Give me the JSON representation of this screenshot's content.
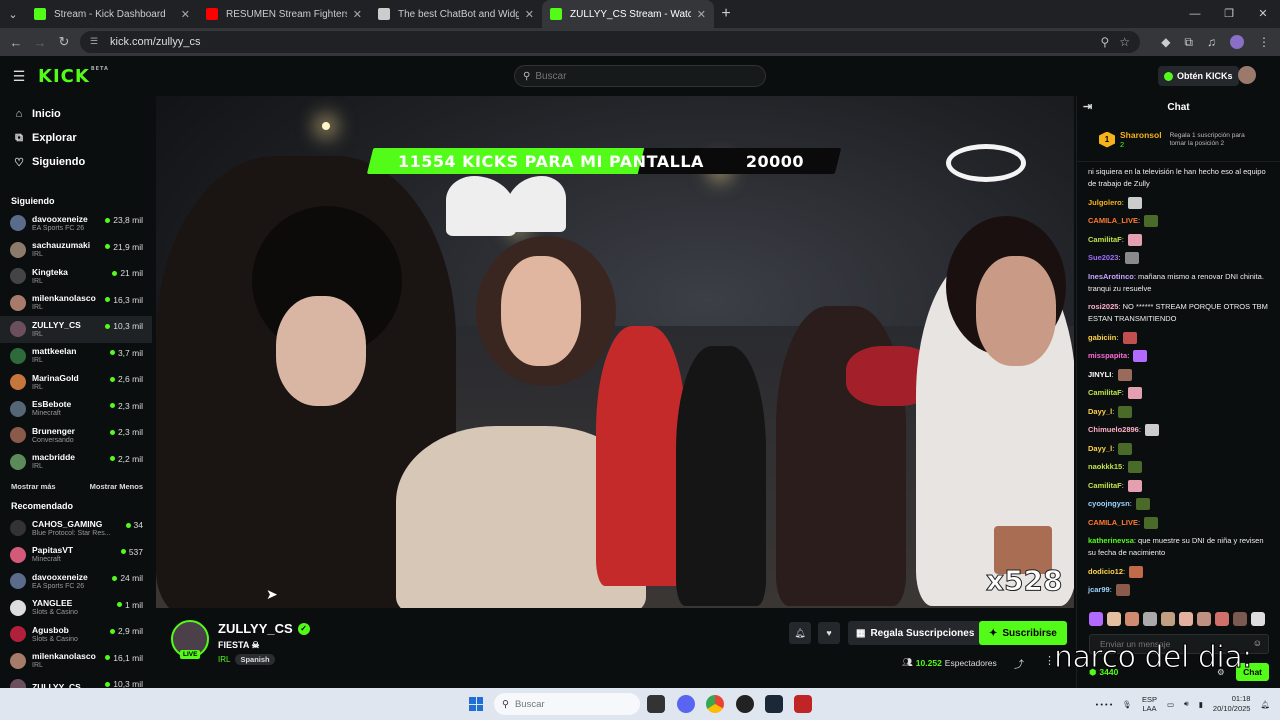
{
  "browser": {
    "tabs": [
      {
        "title": "Stream - Kick Dashboard",
        "color": "#53fc18",
        "active": false
      },
      {
        "title": "RESUMEN Stream Fighters",
        "color": "#ff0000",
        "active": false
      },
      {
        "title": "The best ChatBot and Widgets",
        "color": "#cccccc",
        "active": false
      },
      {
        "title": "ZULLYY_CS Stream - Watch",
        "color": "#53fc18",
        "active": true
      }
    ],
    "url": "kick.com/zullyy_cs"
  },
  "header": {
    "logo": "KICK",
    "logo_badge": "BETA",
    "search_placeholder": "Buscar",
    "kicks_button": "Obtén KICKs"
  },
  "sidebar": {
    "nav": [
      {
        "label": "Inicio",
        "icon": "home-icon"
      },
      {
        "label": "Explorar",
        "icon": "explore-icon"
      },
      {
        "label": "Siguiendo",
        "icon": "heart-icon"
      }
    ],
    "following_title": "Siguiendo",
    "following": [
      {
        "name": "davooxeneize",
        "category": "EA Sports FC 26",
        "viewers": "23,8 mil",
        "color": "#5a6b8c"
      },
      {
        "name": "sachauzumaki",
        "category": "IRL",
        "viewers": "21,9 mil",
        "color": "#8c7a6b"
      },
      {
        "name": "Kingteka",
        "category": "IRL",
        "viewers": "21 mil",
        "color": "#444444"
      },
      {
        "name": "milenkanolasco",
        "category": "IRL",
        "viewers": "16,3 mil",
        "color": "#a77b6a"
      },
      {
        "name": "ZULLYY_CS",
        "category": "IRL",
        "viewers": "10,3 mil",
        "color": "#6b4f5c",
        "selected": true
      },
      {
        "name": "mattkeelan",
        "category": "IRL",
        "viewers": "3,7 mil",
        "color": "#2f6b3a"
      },
      {
        "name": "MarinaGold",
        "category": "IRL",
        "viewers": "2,6 mil",
        "color": "#c6763a"
      },
      {
        "name": "EsBebote",
        "category": "Minecraft",
        "viewers": "2,3 mil",
        "color": "#556677"
      },
      {
        "name": "Brunenger",
        "category": "Conversando",
        "viewers": "2,3 mil",
        "color": "#8a5a4a"
      },
      {
        "name": "macbridde",
        "category": "IRL",
        "viewers": "2,2 mil",
        "color": "#5c8a5a"
      }
    ],
    "show_more": "Mostrar más",
    "show_less": "Mostrar Menos",
    "recommended_title": "Recomendado",
    "recommended": [
      {
        "name": "CAHOS_GAMING",
        "category": "Blue Protocol: Star Res...",
        "viewers": "34",
        "color": "#333333"
      },
      {
        "name": "PapitasVT",
        "category": "Minecraft",
        "viewers": "537",
        "color": "#d45a7a"
      },
      {
        "name": "davooxeneize",
        "category": "EA Sports FC 26",
        "viewers": "24 mil",
        "color": "#5a6b8c"
      },
      {
        "name": "YANGLEE",
        "category": "Slots & Casino",
        "viewers": "1 mil",
        "color": "#dddddd"
      },
      {
        "name": "Agusbob",
        "category": "Slots & Casino",
        "viewers": "2,9 mil",
        "color": "#b0203a"
      },
      {
        "name": "milenkanolasco",
        "category": "IRL",
        "viewers": "16,1 mil",
        "color": "#a77b6a"
      },
      {
        "name": "ZULLYY_CS",
        "category": "",
        "viewers": "10,3 mil",
        "color": "#6b4f5c"
      }
    ]
  },
  "video": {
    "goal_current": "11554",
    "goal_title": "KICKS PARA MI PANTALLA",
    "goal_target": "20000",
    "goal_progress": 0.578,
    "combo": "x528"
  },
  "stream": {
    "name": "ZULLYY_CS",
    "title": "FIESTA ☠",
    "category": "IRL",
    "language": "Spanish",
    "live_badge": "LIVE",
    "gift_button": "Regala Suscripciones",
    "subscribe_button": "Suscribirse",
    "viewers": "10.252",
    "viewers_label": "Espectadores"
  },
  "chat": {
    "title": "Chat",
    "pinned": {
      "rank": "1",
      "user": "Sharonsol",
      "count": "2",
      "note": "Regala 1 suscripción para tomar la posición 2"
    },
    "messages": [
      {
        "user": "",
        "color": "#ffffff",
        "text": "ni siquiera en la televisión le han hecho eso al equipo de trabajo de Zully"
      },
      {
        "user": "Julgolero",
        "color": "#f6b21b",
        "text": "",
        "emote": "#cccccc"
      },
      {
        "user": "CAMILA_LIVE",
        "color": "#ff7a2f",
        "text": "",
        "emote": "#4a6a2a"
      },
      {
        "user": "CamilitaF",
        "color": "#bfe34a",
        "text": "",
        "emote": "#e4a0b0"
      },
      {
        "user": "Sue2023",
        "color": "#a06bff",
        "text": "",
        "emote": "#8a8a8a"
      },
      {
        "user": "InesArotinco",
        "color": "#c7a6ff",
        "text": "mañana mismo a renovar DNI chinita. tranqui zu resuelve"
      },
      {
        "user": "rosi2025",
        "color": "#ffb0c8",
        "text": "NO ****** STREAM PORQUE OTROS TBM ESTAN TRANSMITIENDO"
      },
      {
        "user": "gabiciin",
        "color": "#ffd24a",
        "text": "",
        "emote": "#c05050"
      },
      {
        "user": "misspapita",
        "color": "#ff6ad5",
        "text": "",
        "emote": "#b36bff"
      },
      {
        "user": "JINYLI",
        "color": "#ffffff",
        "text": "",
        "emote": "#9a6a5a"
      },
      {
        "user": "CamilitaF",
        "color": "#bfe34a",
        "text": "",
        "emote": "#e4a0b0"
      },
      {
        "user": "Dayy_l",
        "color": "#ffd24a",
        "text": "",
        "emote": "#4a6a2a"
      },
      {
        "user": "Chimuelo2896",
        "color": "#ffb0c8",
        "text": "",
        "emote": "#cccccc"
      },
      {
        "user": "Dayy_l",
        "color": "#ffd24a",
        "text": "",
        "emote": "#4a6a2a"
      },
      {
        "user": "naokkk15",
        "color": "#bfe34a",
        "text": "",
        "emote": "#4a6a2a"
      },
      {
        "user": "CamilitaF",
        "color": "#bfe34a",
        "text": "",
        "emote": "#e4a0b0"
      },
      {
        "user": "cyoojngysn",
        "color": "#9ad4ff",
        "text": "",
        "emote": "#4a6a2a"
      },
      {
        "user": "CAMILA_LIVE",
        "color": "#ff7a2f",
        "text": "",
        "emote": "#4a6a2a"
      },
      {
        "user": "katherinevsa",
        "color": "#53fc18",
        "text": "que muestre su DNI de niña y revisen su fecha de nacimiento"
      },
      {
        "user": "dodicio12",
        "color": "#ffd24a",
        "text": "",
        "emote": "#c06a4a"
      },
      {
        "user": "jcar99",
        "color": "#9ad4ff",
        "text": "",
        "emote": "#8a5a4a"
      }
    ],
    "input_placeholder": "Enviar un mensaje",
    "points": "3440",
    "send_button": "Chat",
    "overlay_caption": "narco del dia:"
  },
  "taskbar": {
    "search_placeholder": "Buscar",
    "lang": "ESP",
    "lang2": "LAA",
    "time": "01:18",
    "date": "20/10/2025"
  }
}
